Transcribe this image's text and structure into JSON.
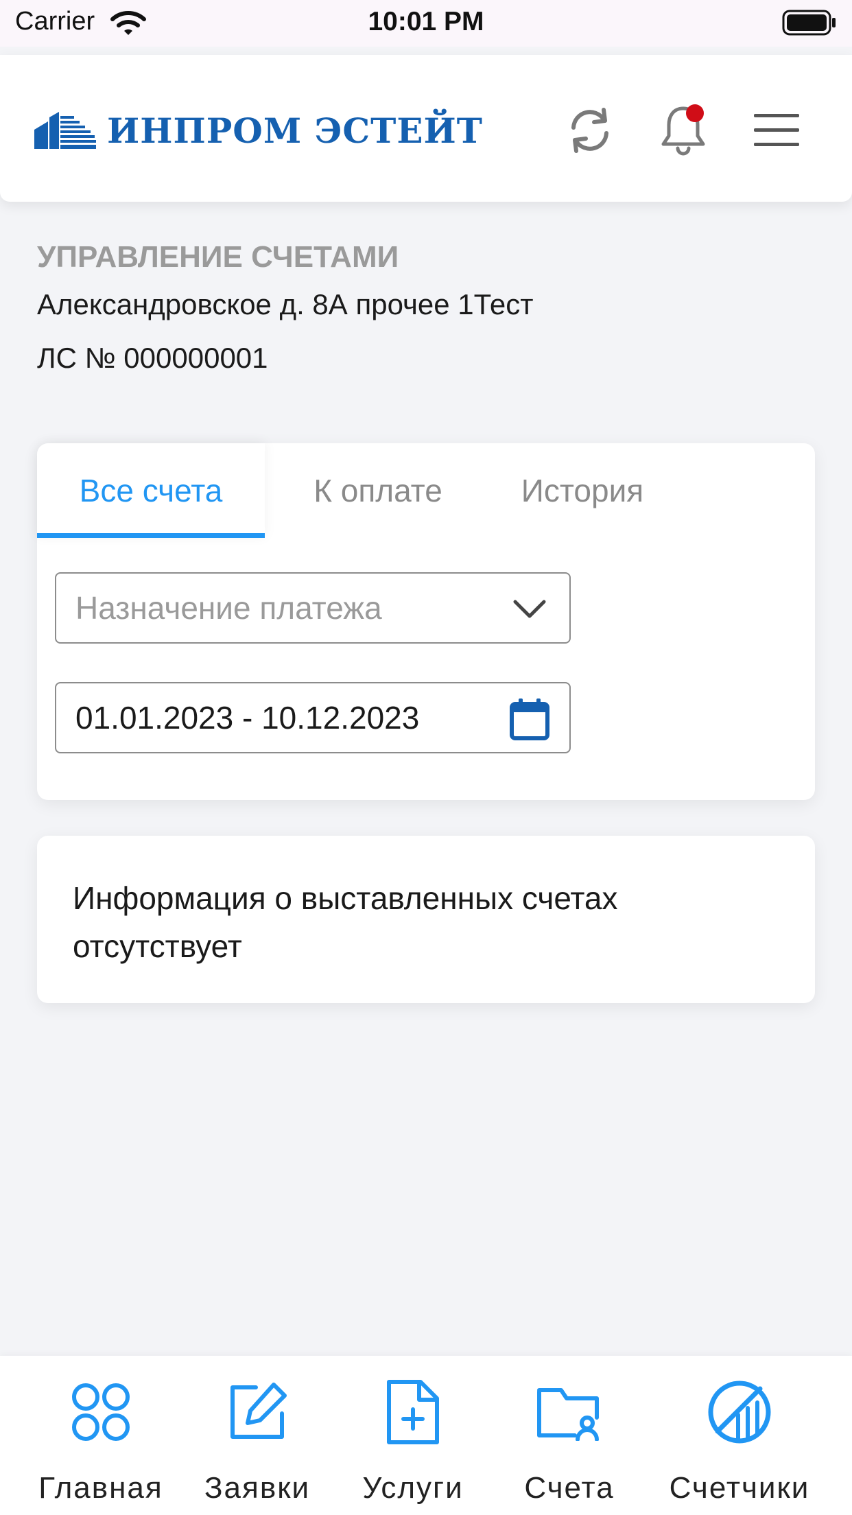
{
  "status_bar": {
    "carrier": "Carrier",
    "time": "10:01 PM"
  },
  "header": {
    "logo_text": "ИНПРОМ ЭСТЕЙТ",
    "icons": [
      "refresh-icon",
      "bell-icon",
      "hamburger-menu-icon"
    ],
    "has_notification": true
  },
  "account": {
    "section_title": "УПРАВЛЕНИЕ СЧЕТАМИ",
    "address": "Александровское д. 8А прочее 1Тест",
    "account_number": "ЛС № 000000001"
  },
  "tabs": [
    {
      "label": "Все счета",
      "active": true
    },
    {
      "label": "К оплате",
      "active": false
    },
    {
      "label": "История",
      "active": false
    }
  ],
  "filters": {
    "purpose_placeholder": "Назначение платежа",
    "date_range": "01.01.2023 - 10.12.2023"
  },
  "info_message": "Информация о выставленных счетах отсутствует",
  "bottom_nav": [
    {
      "label": "Главная",
      "icon": "grid-circles-icon"
    },
    {
      "label": "Заявки",
      "icon": "edit-icon"
    },
    {
      "label": "Услуги",
      "icon": "file-plus-icon"
    },
    {
      "label": "Счета",
      "icon": "folder-user-icon"
    },
    {
      "label": "Счетчики",
      "icon": "meter-icon"
    }
  ],
  "colors": {
    "accent": "#2196f3",
    "brand": "#1560b0",
    "notification": "#d00d17"
  }
}
